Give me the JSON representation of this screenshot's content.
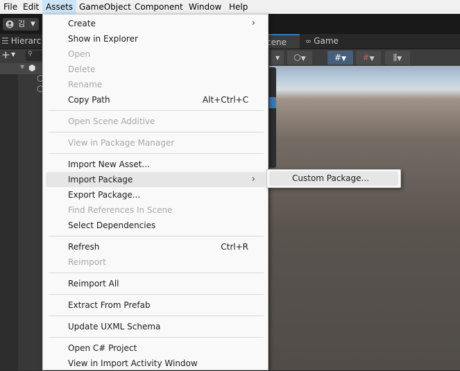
{
  "menubar": {
    "items": [
      {
        "label": "File"
      },
      {
        "label": "Edit"
      },
      {
        "label": "Assets"
      },
      {
        "label": "GameObject"
      },
      {
        "label": "Component"
      },
      {
        "label": "Window"
      },
      {
        "label": "Help"
      }
    ]
  },
  "toolbar": {
    "account_label": "김"
  },
  "tabs": {
    "hierarchy": "Hierarc",
    "scene": "cene",
    "game": "Game"
  },
  "assets_menu": {
    "items": [
      {
        "label": "Create",
        "disabled": false
      },
      {
        "label": "Show in Explorer",
        "disabled": false
      },
      {
        "label": "Open",
        "disabled": true
      },
      {
        "label": "Delete",
        "disabled": true
      },
      {
        "label": "Rename",
        "disabled": true
      },
      {
        "label": "Copy Path",
        "shortcut": "Alt+Ctrl+C",
        "disabled": false
      },
      {
        "label": "Open Scene Additive",
        "disabled": true
      },
      {
        "label": "View in Package Manager",
        "disabled": true
      },
      {
        "label": "Import New Asset...",
        "disabled": false
      },
      {
        "label": "Import Package",
        "disabled": false,
        "highlighted": true
      },
      {
        "label": "Export Package...",
        "disabled": false
      },
      {
        "label": "Find References In Scene",
        "disabled": true
      },
      {
        "label": "Select Dependencies",
        "disabled": false
      },
      {
        "label": "Refresh",
        "shortcut": "Ctrl+R",
        "disabled": false
      },
      {
        "label": "Reimport",
        "disabled": true
      },
      {
        "label": "Reimport All",
        "disabled": false
      },
      {
        "label": "Extract From Prefab",
        "disabled": false
      },
      {
        "label": "Update UXML Schema",
        "disabled": false
      },
      {
        "label": "Open C# Project",
        "disabled": false
      },
      {
        "label": "View in Import Activity Window",
        "disabled": false
      }
    ]
  },
  "import_package_submenu": {
    "items": [
      {
        "label": "Custom Package..."
      }
    ]
  }
}
